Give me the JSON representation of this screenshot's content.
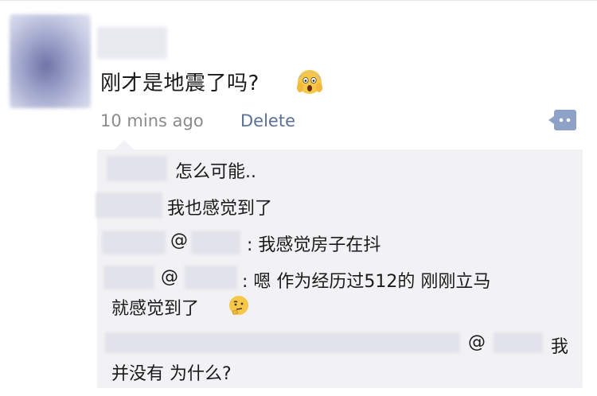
{
  "post": {
    "text": "刚才是地震了吗?",
    "time": "10 mins ago",
    "delete_label": "Delete"
  },
  "comments": [
    {
      "text": "怎么可能.."
    },
    {
      "text": "我也感觉到了"
    },
    {
      "at": "@",
      "text": ": 我感觉房子在抖"
    },
    {
      "at": "@",
      "text_line1": ": 嗯 作为经历过512的 刚刚立马",
      "text_line2": "就感觉到了"
    },
    {
      "at": "@",
      "text_line1": "我",
      "text_line2": "并没有 为什么?"
    }
  ],
  "colors": {
    "link": "#5a7096",
    "meta": "#8a8a8a",
    "comment_bg": "#f2f2f5",
    "icon": "#8ea2c7"
  },
  "icons": {
    "post_emoji": "face-screaming-in-fear-icon",
    "comment_emoji": "thinking-face-icon",
    "comment_action": "comment-bubble-icon"
  }
}
